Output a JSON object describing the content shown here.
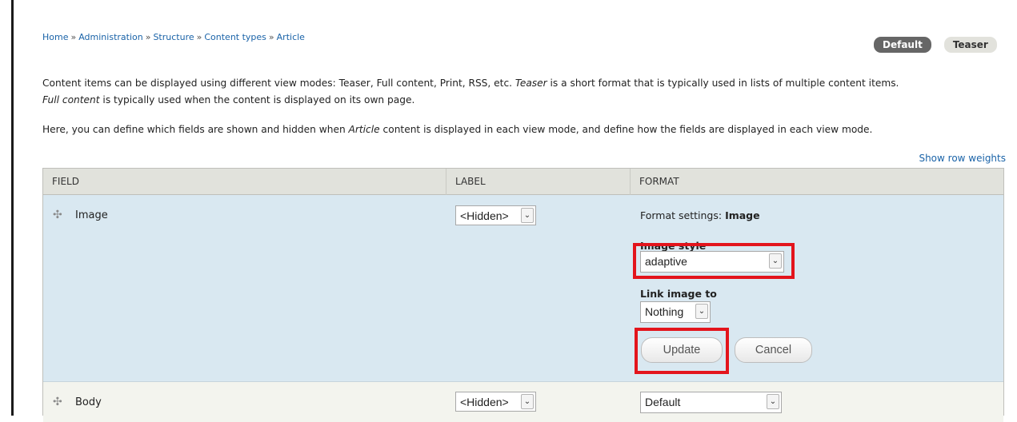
{
  "breadcrumb": {
    "items": [
      "Home",
      "Administration",
      "Structure",
      "Content types",
      "Article"
    ],
    "separator": "»"
  },
  "view_mode_tabs": [
    {
      "label": "Default",
      "active": true
    },
    {
      "label": "Teaser",
      "active": false
    }
  ],
  "description": {
    "p1_a": "Content items can be displayed using different view modes: Teaser, Full content, Print, RSS, etc. ",
    "p1_teaser": "Teaser",
    "p1_b": " is a short format that is typically used in lists of multiple content items.",
    "p1_full": "Full content",
    "p1_c": " is typically used when the content is displayed on its own page.",
    "p2_a": "Here, you can define which fields are shown and hidden when ",
    "p2_article": "Article",
    "p2_b": " content is displayed in each view mode, and define how the fields are displayed in each view mode."
  },
  "show_row_weights": "Show row weights",
  "table": {
    "headers": {
      "field": "FIELD",
      "label": "LABEL",
      "format": "FORMAT"
    },
    "rows": [
      {
        "field": "Image",
        "label_select": "<Hidden>",
        "format_settings": {
          "prefix": "Format settings: ",
          "name": "Image",
          "image_style_label": "Image style",
          "image_style_value": "adaptive",
          "link_label": "Link image to",
          "link_value": "Nothing",
          "update_button": "Update",
          "cancel_button": "Cancel"
        }
      },
      {
        "field": "Body",
        "label_select": "<Hidden>",
        "format_select": "Default"
      }
    ]
  },
  "icons": {
    "drag": "move-handle-icon",
    "select_arrow": "chevron-down-icon"
  },
  "colors": {
    "link": "#1a63a8",
    "active_tab": "#666666",
    "highlight": "#e3141c",
    "row_edit_bg": "#d9e8f1",
    "header_bg": "#e1e2dc"
  }
}
